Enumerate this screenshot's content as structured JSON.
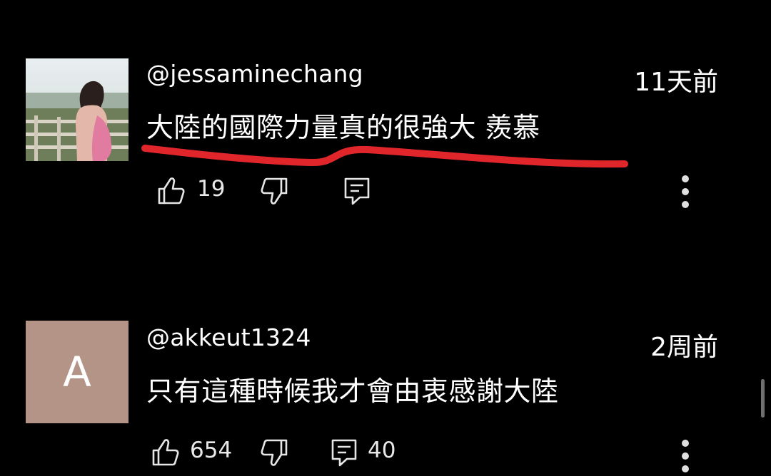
{
  "comments": [
    {
      "username": "@jessaminechang",
      "time": "11天前",
      "text": "大陸的國際力量真的很強大 羨慕",
      "likes": "19",
      "replies": "",
      "avatar": {
        "type": "photo"
      },
      "highlight_color": "#e0262b"
    },
    {
      "username": "@akkeut1324",
      "time": "2周前",
      "text": "只有這種時候我才會由衷感謝大陸",
      "likes": "654",
      "replies": "40",
      "avatar": {
        "type": "letter",
        "letter": "A",
        "color": "#b59488"
      }
    }
  ],
  "icons": {
    "like": "thumbs-up-icon",
    "dislike": "thumbs-down-icon",
    "reply": "reply-icon",
    "more": "more-vertical-icon"
  },
  "colors": {
    "background": "#000000",
    "text": "#ffffff",
    "highlight": "#e0262b"
  }
}
